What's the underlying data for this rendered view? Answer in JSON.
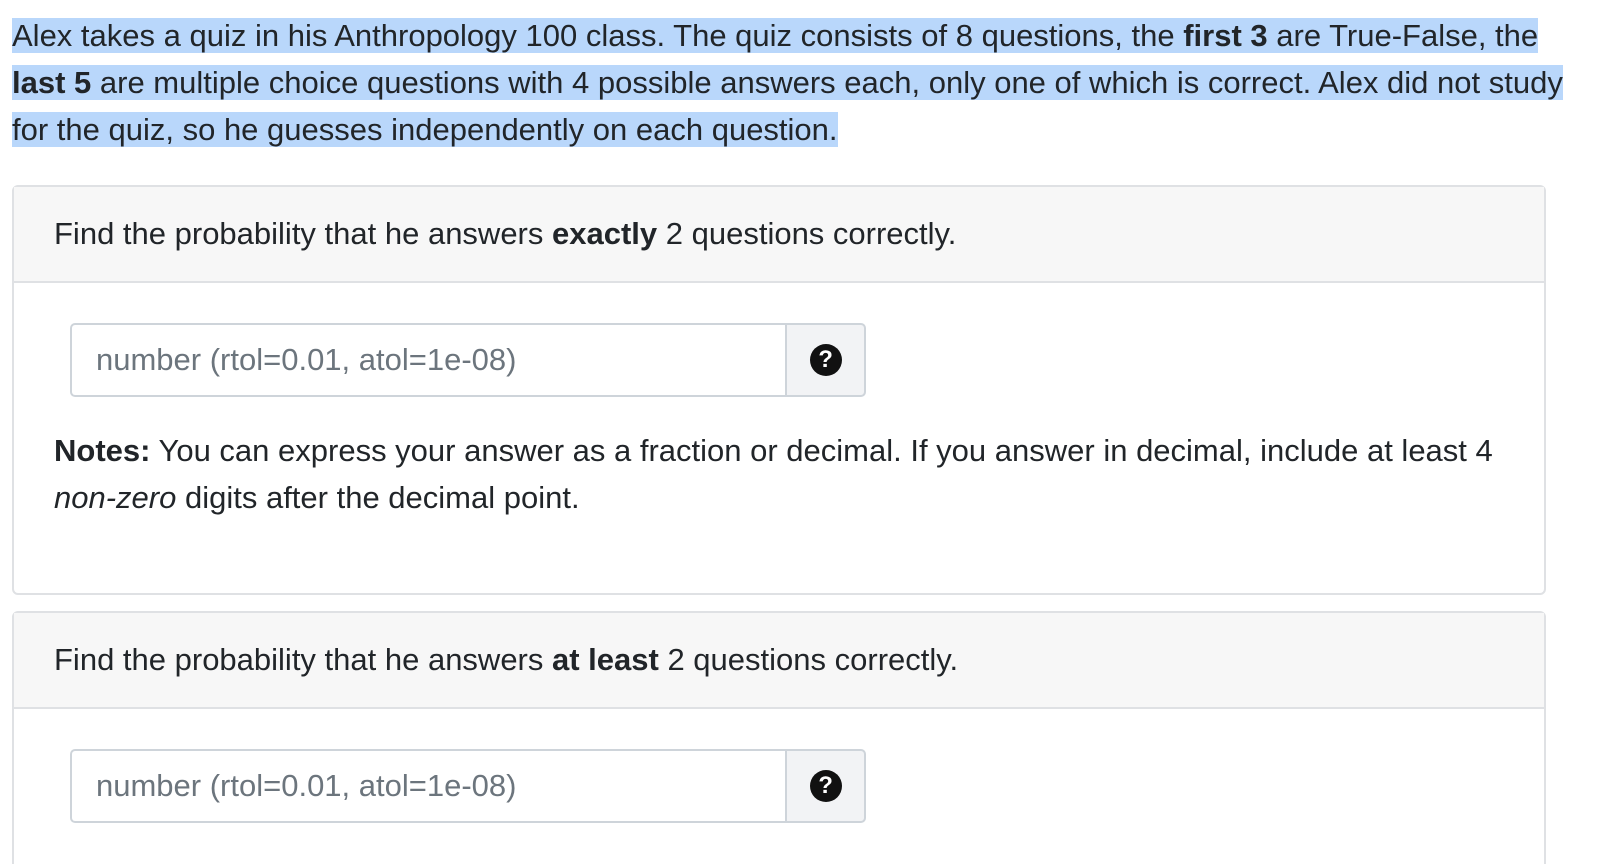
{
  "intro": {
    "part1": "Alex takes a quiz in his Anthropology 100 class. The quiz consists of 8 questions, the ",
    "bold1": "first 3",
    "part2": " are True-False, the ",
    "bold2": "last 5",
    "part3": " are multiple choice questions with 4 possible answers each, only one of which is correct. Alex did not study for the quiz, so he guesses independently on each question."
  },
  "questions": [
    {
      "prefix": "Find the probability that he answers ",
      "emphasis": "exactly",
      "suffix": " 2 questions correctly.",
      "placeholder": "number (rtol=0.01, atol=1e-08)",
      "value": "",
      "help_icon": "question-circle-icon"
    },
    {
      "prefix": "Find the probability that he answers ",
      "emphasis": "at least",
      "suffix": " 2 questions correctly.",
      "placeholder": "number (rtol=0.01, atol=1e-08)",
      "value": "",
      "help_icon": "question-circle-icon"
    }
  ],
  "notes": {
    "label": "Notes:",
    "text1": " You can express your answer as a fraction or decimal. If you answer in decimal, include at least 4 ",
    "italic": "non-zero",
    "text2": " digits after the decimal point."
  },
  "colors": {
    "selection_highlight": "#b9d7fb",
    "card_header_bg": "#f7f7f7",
    "border": "#dfe1e4"
  }
}
